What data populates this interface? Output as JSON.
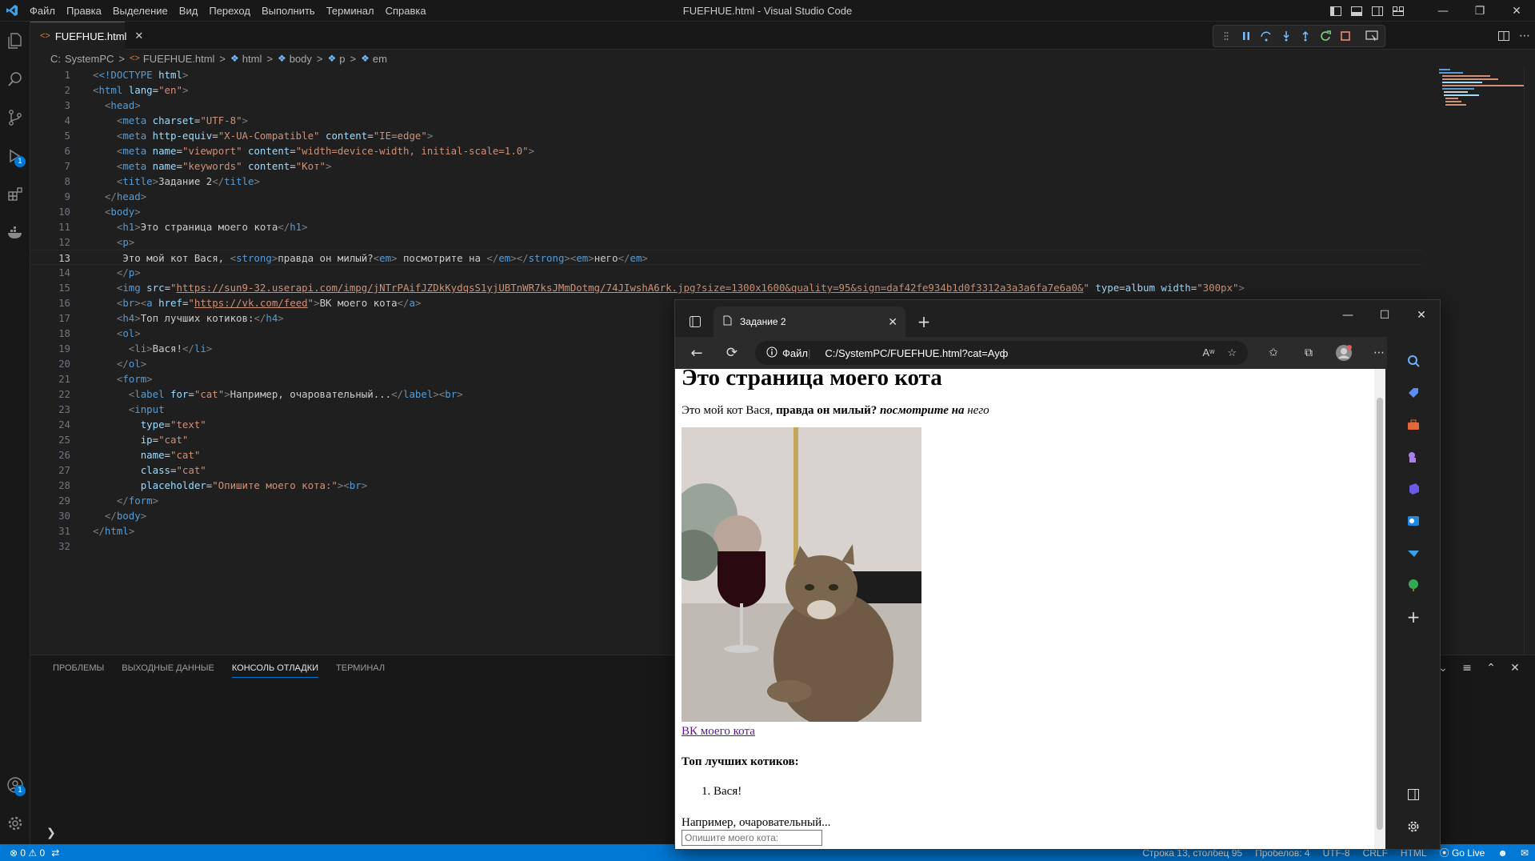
{
  "app": {
    "window_title": "FUEFHUE.html - Visual Studio Code",
    "menu": [
      "Файл",
      "Правка",
      "Выделение",
      "Вид",
      "Переход",
      "Выполнить",
      "Терминал",
      "Справка"
    ]
  },
  "editor": {
    "tab_label": "FUEFHUE.html",
    "breadcrumb": [
      "C:",
      "SystemPC",
      "FUEFHUE.html",
      "html",
      "body",
      "p",
      "em"
    ],
    "line_numbers": [
      "1",
      "2",
      "3",
      "4",
      "5",
      "6",
      "7",
      "8",
      "9",
      "10",
      "11",
      "12",
      "13",
      "14",
      "15",
      "16",
      "17",
      "18",
      "19",
      "20",
      "21",
      "22",
      "23",
      "24",
      "25",
      "26",
      "27",
      "28",
      "29",
      "30",
      "31",
      "32"
    ],
    "current_line": 13,
    "code": {
      "l1_a": "<!DOCTYPE",
      "l1_b": " html",
      "l1_c": ">",
      "l2_lang": "\"en\"",
      "l4_charset": "\"UTF-8\"",
      "l5_equiv": "\"X-UA-Compatible\"",
      "l5_content": "\"IE=edge\"",
      "l6_name": "\"viewport\"",
      "l6_content": "\"width=device-width, initial-scale=1.0\"",
      "l7_name": "\"keywords\"",
      "l7_content": "\"Кот\"",
      "l8_text": "Задание 2",
      "l11_text": "Это страница моего кота",
      "l13_a": "Это мой кот Вася, ",
      "l13_b": "правда он милый?",
      "l13_c": " посмотрите на ",
      "l13_d": "него",
      "l15_url": "https://sun9-32.userapi.com/impg/jNTrPAifJZDkKydqsS1yjUBTnWR7ksJMmDotmg/74JIwshA6rk.jpg?size=1300x1600&quality=95&sign=daf42fe934b1d0f3312a3a3a6fa7e6a0&",
      "l15_type": "album",
      "l15_width": "\"300px\"",
      "l16_href": "https://vk.com/feed",
      "l16_text": "ВК моего кота",
      "l17_text": "Топ лучших котиков:",
      "l19_text": "Вася!",
      "l22_for": "\"cat\"",
      "l22_text": "Например, очаровательный...",
      "l24_v": "\"text\"",
      "l25_v": "\"cat\"",
      "l26_v": "\"cat\"",
      "l27_v": "\"cat\"",
      "l28_v": "\"Опишите моего кота:\""
    }
  },
  "panel": {
    "tabs": [
      "ПРОБЛЕМЫ",
      "ВЫХОДНЫЕ ДАННЫЕ",
      "КОНСОЛЬ ОТЛАДКИ",
      "ТЕРМИНАЛ"
    ],
    "active_tab": "КОНСОЛЬ ОТЛАДКИ"
  },
  "statusbar": {
    "errors": "0",
    "warnings": "0",
    "position": "Строка 13, столбец 95",
    "spaces": "Пробелов: 4",
    "encoding": "UTF-8",
    "eol": "CRLF",
    "language": "HTML",
    "golive": "Go Live"
  },
  "browser": {
    "tab_title": "Задание 2",
    "site_info": "Файл",
    "url": "C:/SystemPC/FUEFHUE.html?cat=Ауф",
    "page": {
      "h1": "Это страница моего кота",
      "p_plain": "Это мой кот Вася, ",
      "p_strong": "правда он милый?",
      "p_strong_em": " посмотрите на ",
      "p_em": "него",
      "link": "ВК моего кота",
      "h4": "Топ лучших котиков:",
      "list": [
        "Вася!"
      ],
      "label": "Например, очаровательный...",
      "input_placeholder": "Опишите моего кота:"
    }
  },
  "colors": {
    "accent": "#0078d4",
    "tag": "#569cd6",
    "attr": "#9cdcfe",
    "string": "#ce9178"
  }
}
